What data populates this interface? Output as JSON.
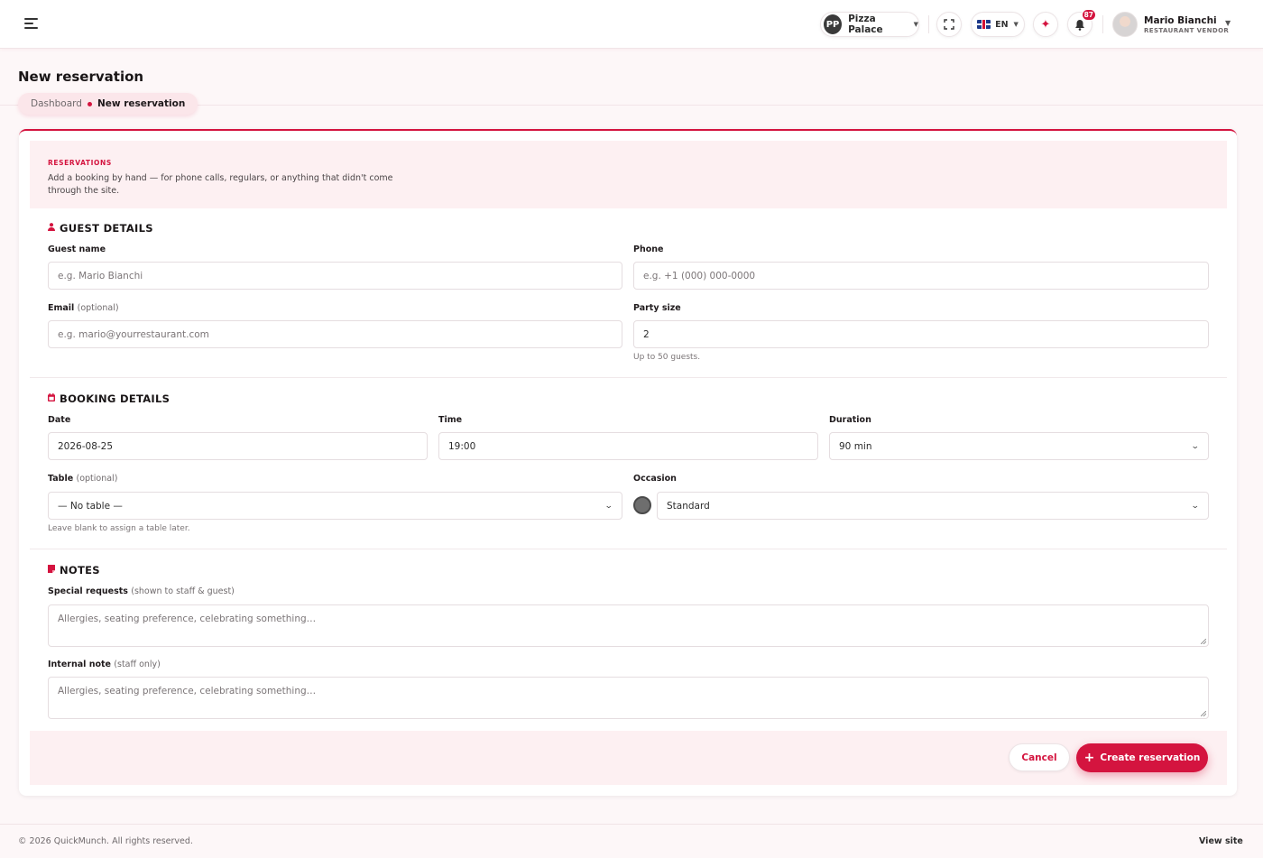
{
  "header": {
    "restaurant": {
      "initials": "PP",
      "name": "Pizza Palace"
    },
    "language": "EN",
    "notifications_count": "87",
    "user": {
      "name": "Mario Bianchi",
      "role": "RESTAURANT VENDOR"
    }
  },
  "page": {
    "title": "New reservation",
    "breadcrumb": {
      "home": "Dashboard",
      "current": "New reservation"
    }
  },
  "intro": {
    "eyebrow": "RESERVATIONS",
    "text": "Add a booking by hand — for phone calls, regulars, or anything that didn't come through the site."
  },
  "guest": {
    "title": "GUEST DETAILS",
    "name_label": "Guest name",
    "name_placeholder": "e.g. Mario Bianchi",
    "phone_label": "Phone",
    "phone_placeholder": "e.g. +1 (000) 000-0000",
    "email_label": "Email",
    "email_optional": "(optional)",
    "email_placeholder": "e.g. mario@yourrestaurant.com",
    "party_label": "Party size",
    "party_value": "2",
    "party_hint": "Up to 50 guests."
  },
  "booking": {
    "title": "BOOKING DETAILS",
    "date_label": "Date",
    "date_value": "2026-08-25",
    "time_label": "Time",
    "time_value": "19:00",
    "duration_label": "Duration",
    "duration_value": "90 min",
    "table_label": "Table",
    "table_optional": "(optional)",
    "table_value": "— No table —",
    "table_hint": "Leave blank to assign a table later.",
    "occasion_label": "Occasion",
    "occasion_value": "Standard",
    "occasion_color": "#6e6e6e"
  },
  "notes": {
    "title": "NOTES",
    "special_label": "Special requests",
    "special_sub": "(shown to staff & guest)",
    "special_placeholder": "Allergies, seating preference, celebrating something…",
    "internal_label": "Internal note",
    "internal_sub": "(staff only)",
    "internal_placeholder": "Allergies, seating preference, celebrating something…"
  },
  "actions": {
    "cancel": "Cancel",
    "create": "Create reservation"
  },
  "footer": {
    "copyright": "© 2026 QuickMunch. All rights reserved.",
    "view_site": "View site"
  },
  "colors": {
    "accent": "#d4143f",
    "intro_bg": "#fdf0f2",
    "page_bg": "#fdf7f8"
  }
}
